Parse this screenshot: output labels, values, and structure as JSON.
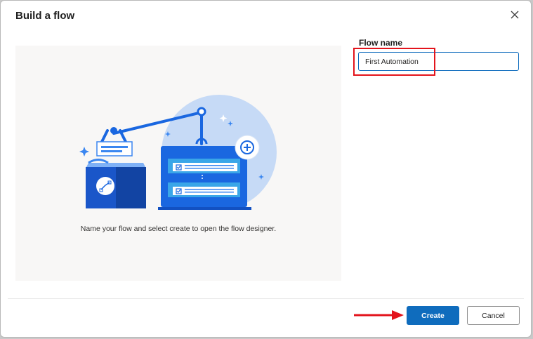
{
  "dialog": {
    "title": "Build a flow",
    "close_icon": "close-icon"
  },
  "illustration": {
    "caption": "Name your flow and select create to open the flow designer.",
    "icon": "robot-arm-automation-illustration"
  },
  "form": {
    "flow_name_label": "Flow name",
    "flow_name_value": "First Automation"
  },
  "footer": {
    "create_label": "Create",
    "cancel_label": "Cancel"
  },
  "annotation": {
    "highlight_color": "#e3141c",
    "arrow_color": "#e3141c"
  },
  "colors": {
    "accent": "#0f6cbd"
  }
}
